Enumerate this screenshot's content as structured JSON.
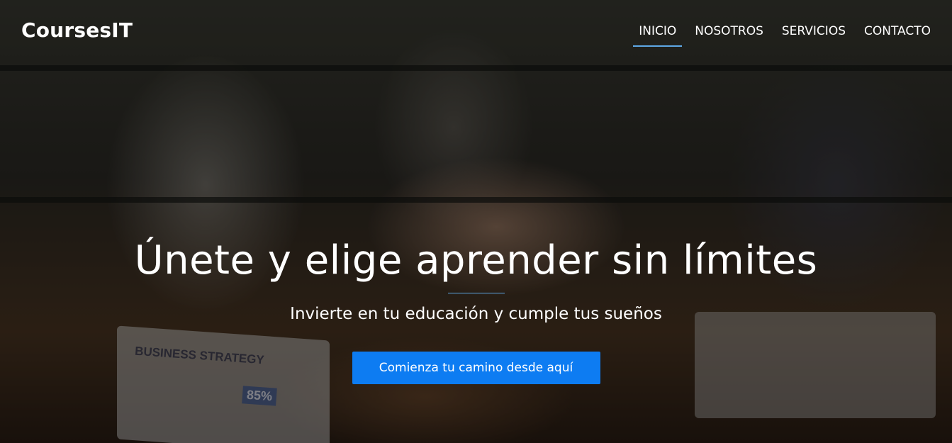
{
  "navbar": {
    "brand": "CoursesIT",
    "items": [
      {
        "label": "INICIO",
        "active": true
      },
      {
        "label": "NOSOTROS",
        "active": false
      },
      {
        "label": "SERVICIOS",
        "active": false
      },
      {
        "label": "CONTACTO",
        "active": false
      }
    ],
    "active_underline_color": "#5ea8e6"
  },
  "hero": {
    "title": "Únete y elige aprender sin límites",
    "subtitle": "Invierte en tu educación y cumple tus sueños",
    "cta_label": "Comienza tu camino desde aquí",
    "cta_color": "#0d7cf2",
    "background_image_text": {
      "laptop_heading": "BUSINESS STRATEGY",
      "laptop_percentage": "85%"
    }
  }
}
